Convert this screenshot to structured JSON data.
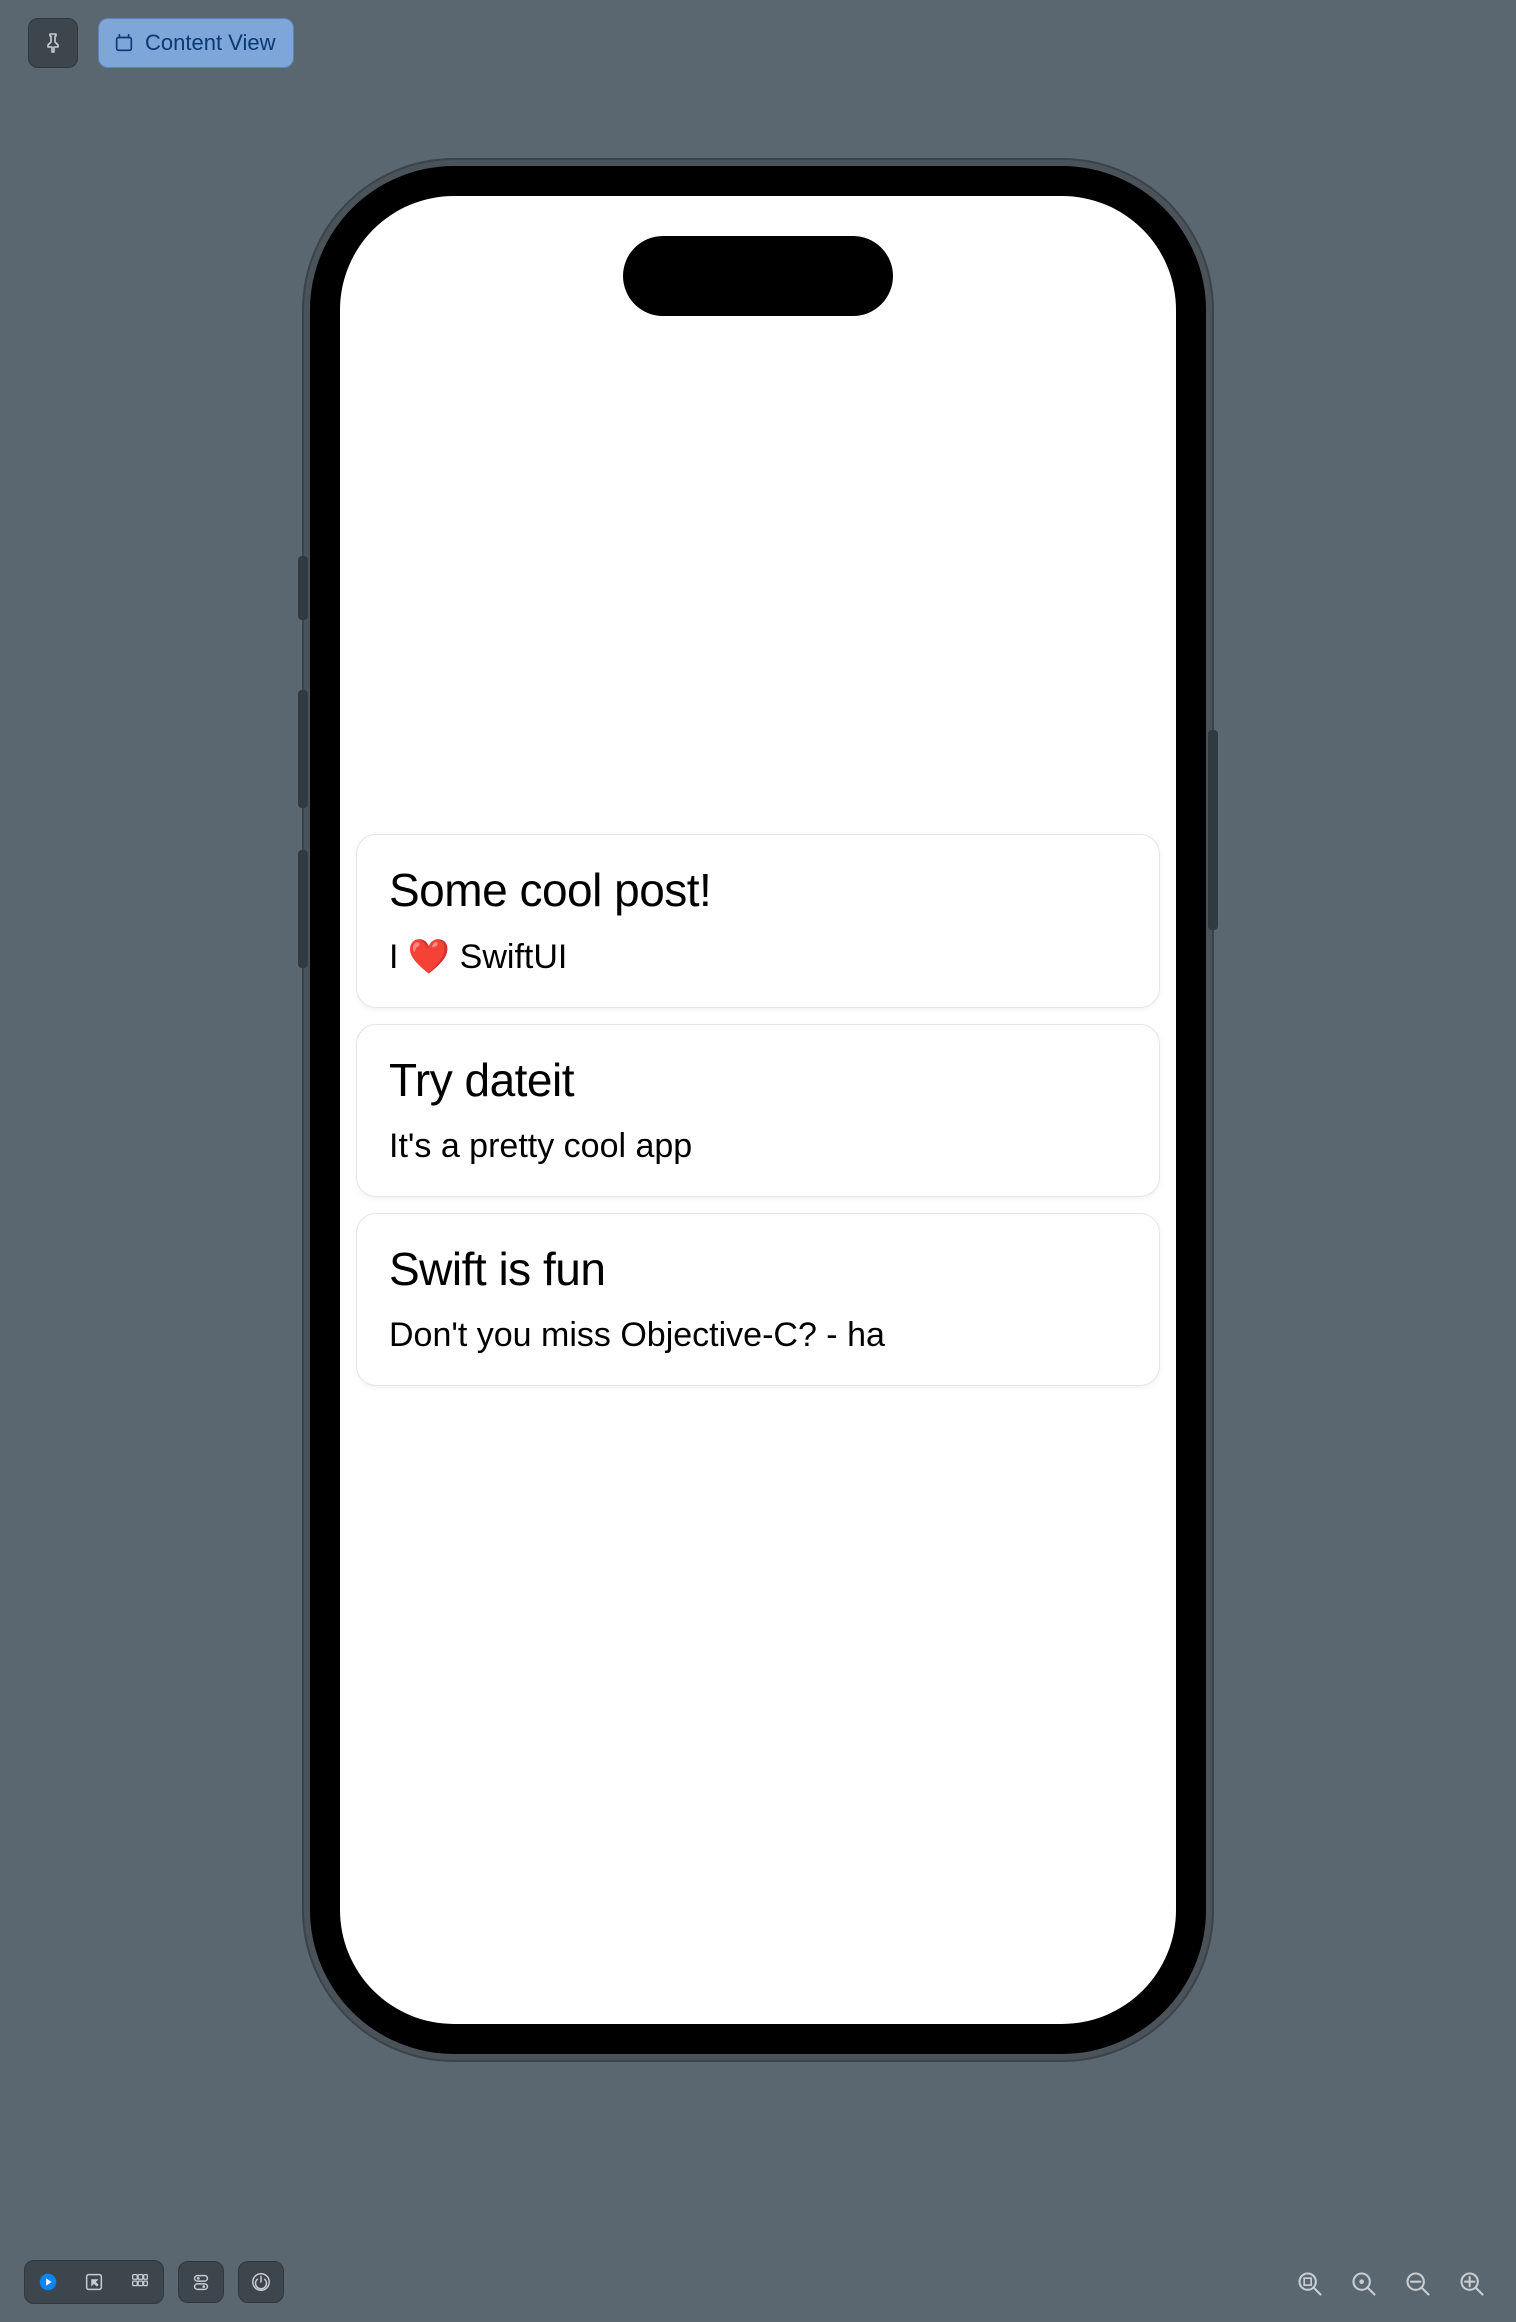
{
  "toolbar": {
    "content_view_label": "Content View"
  },
  "posts": [
    {
      "title": "Some cool post!",
      "body": "I ❤️ SwiftUI"
    },
    {
      "title": "Try dateit",
      "body": "It's a pretty cool app"
    },
    {
      "title": "Swift is fun",
      "body": "Don't you miss Objective-C? - ha"
    }
  ]
}
